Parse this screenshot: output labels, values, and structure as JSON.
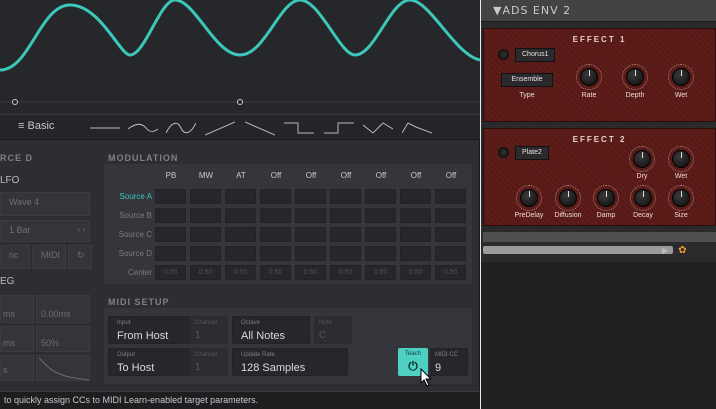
{
  "back_window": {
    "header_title": "▼ADS ENV 2",
    "effect1": {
      "title": "EFFECT 1",
      "preset": "Chorus1",
      "type_value": "Ensemble",
      "labels": [
        "Type",
        "Rate",
        "Depth",
        "Wet"
      ]
    },
    "effect2": {
      "title": "EFFECT 2",
      "preset": "Plate2",
      "labels": [
        "Dry",
        "Wet",
        "PreDelay",
        "Diffusion",
        "Damp",
        "Decay",
        "Size"
      ]
    },
    "accent_color": "#f29a2e"
  },
  "shape_bar": {
    "menu_label": "Basic",
    "shapes": [
      "line-flat",
      "sine-short",
      "sine",
      "ramp-up",
      "ramp-down",
      "square",
      "square-inverse",
      "triangle-wave",
      "envelope"
    ]
  },
  "left_column": {
    "source_header": "RCE D",
    "lfo_label": "LFO",
    "wave_value": "Wave 4",
    "rate_value": "1 Bar",
    "sync_label": "nc",
    "midi_label": "MIDI",
    "eg_label": "EG",
    "eg_values": [
      "ms",
      "0.00ms",
      "ms",
      "50%"
    ],
    "eg_bottom": "s"
  },
  "modulation": {
    "title": "MODULATION",
    "columns": [
      "PB",
      "MW",
      "AT",
      "Off",
      "Off",
      "Off",
      "Off",
      "Off",
      "Off"
    ],
    "rows": [
      {
        "label": "Source A",
        "active": true
      },
      {
        "label": "Source B",
        "active": false
      },
      {
        "label": "Source C",
        "active": false
      },
      {
        "label": "Source D",
        "active": false
      }
    ],
    "center_label": "Center",
    "center_values": [
      "0.00",
      "0.50",
      "0.50",
      "0.50",
      "0.50",
      "0.50",
      "0.50",
      "0.50",
      "0.50"
    ]
  },
  "midi_setup": {
    "title": "MIDI SETUP",
    "input_label": "Input",
    "input_value": "From Host",
    "input_channel_label": "Channel",
    "input_channel_value": "1",
    "octave_label": "Octave",
    "octave_value": "All Notes",
    "note_label": "Note",
    "note_value": "C",
    "output_label": "Output",
    "output_value": "To Host",
    "output_channel_label": "Channel",
    "output_channel_value": "1",
    "update_rate_label": "Update Rate",
    "update_rate_value": "128 Samples",
    "teach_label": "Teach",
    "teach_icon": "⏻",
    "midicc_label": "MIDI CC",
    "midicc_value": "9",
    "teach_color": "#4ed0c3"
  },
  "status_bar": {
    "text": "to quickly assign CCs to MIDI Learn-enabled target parameters."
  },
  "wave_color": "#3cc7bb"
}
